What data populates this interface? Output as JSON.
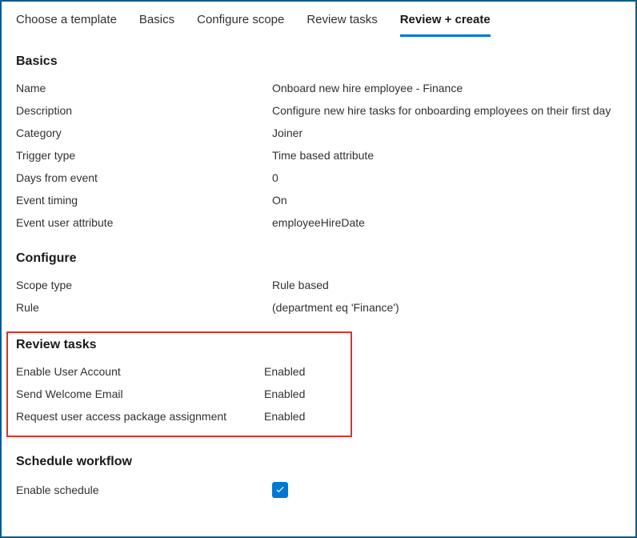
{
  "tabs": [
    {
      "label": "Choose a template",
      "active": false
    },
    {
      "label": "Basics",
      "active": false
    },
    {
      "label": "Configure scope",
      "active": false
    },
    {
      "label": "Review tasks",
      "active": false
    },
    {
      "label": "Review + create",
      "active": true
    }
  ],
  "sections": {
    "basics": {
      "heading": "Basics",
      "rows": [
        {
          "label": "Name",
          "value": "Onboard new hire employee - Finance"
        },
        {
          "label": "Description",
          "value": "Configure new hire tasks for onboarding employees on their first day"
        },
        {
          "label": "Category",
          "value": "Joiner"
        },
        {
          "label": "Trigger type",
          "value": "Time based attribute"
        },
        {
          "label": "Days from event",
          "value": "0"
        },
        {
          "label": "Event timing",
          "value": "On"
        },
        {
          "label": "Event user attribute",
          "value": "employeeHireDate"
        }
      ]
    },
    "configure": {
      "heading": "Configure",
      "rows": [
        {
          "label": "Scope type",
          "value": "Rule based"
        },
        {
          "label": "Rule",
          "value": " (department eq 'Finance')"
        }
      ]
    },
    "reviewTasks": {
      "heading": "Review tasks",
      "rows": [
        {
          "label": "Enable User Account",
          "value": "Enabled"
        },
        {
          "label": "Send Welcome Email",
          "value": "Enabled"
        },
        {
          "label": "Request user access package assignment",
          "value": "Enabled"
        }
      ]
    },
    "schedule": {
      "heading": "Schedule workflow",
      "enableLabel": "Enable schedule",
      "enabled": true
    }
  }
}
